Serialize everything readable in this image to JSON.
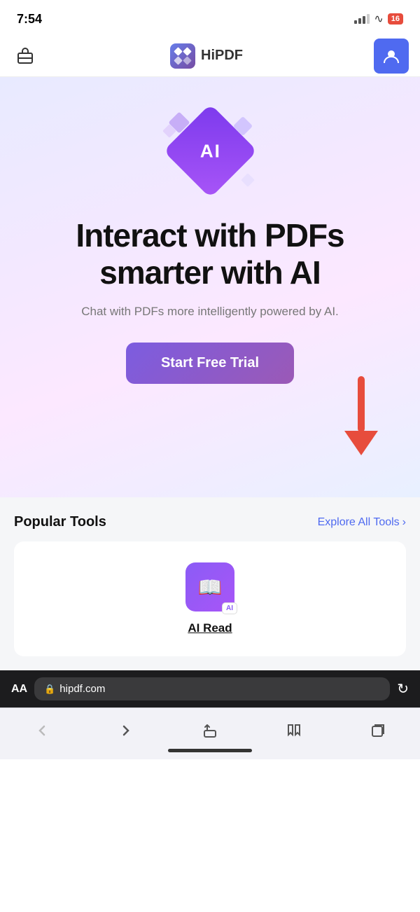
{
  "status_bar": {
    "time": "7:54",
    "battery_level": "16"
  },
  "nav_bar": {
    "logo_text": "HiPDF"
  },
  "hero": {
    "ai_label": "AI",
    "title_line1": "Interact with PDFs",
    "title_line2": "smarter with AI",
    "subtitle": "Chat with PDFs more intelligently powered by AI.",
    "cta_label": "Start Free Trial"
  },
  "popular_tools": {
    "section_title": "Popular Tools",
    "explore_label": "Explore All Tools",
    "tool_ai_badge": "AI",
    "tool_name": "AI Read"
  },
  "browser_bar": {
    "aa_label": "AA",
    "url": "hipdf.com"
  }
}
